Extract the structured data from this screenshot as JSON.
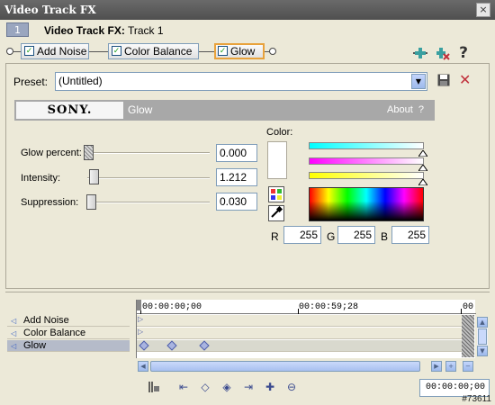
{
  "window": {
    "title": "Video Track FX",
    "close_glyph": "×"
  },
  "track": {
    "number": "1",
    "label_bold": "Video Track FX:",
    "label_value": "Track 1"
  },
  "fx_chain": [
    {
      "label": "Add Noise",
      "checked": true
    },
    {
      "label": "Color Balance",
      "checked": true
    },
    {
      "label": "Glow",
      "checked": true,
      "active": true
    }
  ],
  "toolbar_icons": [
    "plug-in-chain-icon",
    "remove-plug-in-icon",
    "help-icon"
  ],
  "help_glyph": "?",
  "preset": {
    "label": "Preset:",
    "value": "(Untitled)"
  },
  "plugin_header": {
    "brand": "SONY.",
    "name": "Glow",
    "about": "About",
    "about_q": "?"
  },
  "sliders": [
    {
      "label": "Glow percent:",
      "value": "0.000",
      "fraction": 0.0
    },
    {
      "label": "Intensity:",
      "value": "1.212",
      "fraction": 0.03
    },
    {
      "label": "Suppression:",
      "value": "0.030",
      "fraction": 0.0
    }
  ],
  "color": {
    "label": "Color:",
    "gradients": [
      "#00ffff",
      "#ff00ff",
      "#ffff00"
    ],
    "r_label": "R",
    "g_label": "G",
    "b_label": "B",
    "r": "255",
    "g": "255",
    "b": "255"
  },
  "timeline": {
    "tracks": [
      {
        "label": "Add Noise",
        "selected": false
      },
      {
        "label": "Color Balance",
        "selected": false
      },
      {
        "label": "Glow",
        "selected": true
      }
    ],
    "ruler": [
      "00:00:00;00",
      "00:00:59;28",
      "00"
    ],
    "time": "00:00:00;00"
  },
  "watermark": "#73611"
}
